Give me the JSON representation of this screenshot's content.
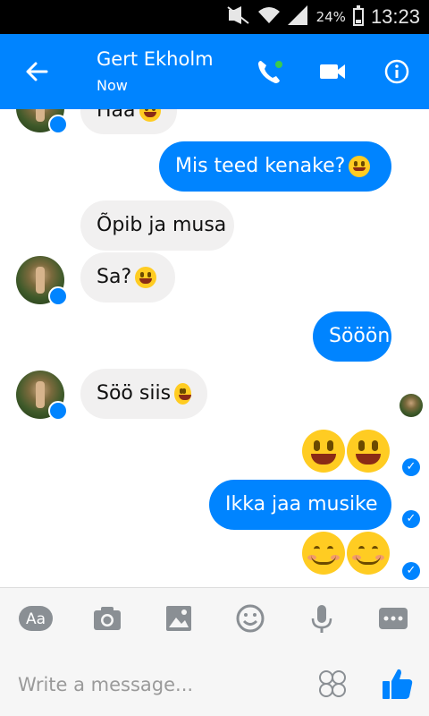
{
  "status_bar": {
    "battery_percent": "24%",
    "time": "13:23",
    "icons": [
      "mute-icon",
      "wifi-icon",
      "signal-icon",
      "battery-icon"
    ]
  },
  "header": {
    "contact_name": "Gert Ekholm",
    "contact_status": "Now",
    "icons": [
      "back-arrow-icon",
      "phone-icon",
      "video-camera-icon",
      "info-icon"
    ],
    "accent_color": "#0084ff"
  },
  "messages": [
    {
      "direction": "in",
      "text": "Hää",
      "emoji": "grin"
    },
    {
      "direction": "out",
      "text": "Mis teed kenake?",
      "emoji": "smile"
    },
    {
      "direction": "in",
      "text": "Õpib ja musa",
      "emoji": null
    },
    {
      "direction": "in",
      "text": "Sa?",
      "emoji": "grin"
    },
    {
      "direction": "out",
      "text": "Sööön",
      "emoji": null
    },
    {
      "direction": "in",
      "text": "Söö siis",
      "emoji": "grin"
    },
    {
      "direction": "out",
      "text": "",
      "emoji": "grin-grin"
    },
    {
      "direction": "out",
      "text": "Ikka jaa musike",
      "emoji": null
    },
    {
      "direction": "out",
      "text": "",
      "emoji": "blush-blush"
    }
  ],
  "toolbar": {
    "text_button_label": "Aa",
    "icons": [
      "camera-icon",
      "gallery-icon",
      "emoji-icon",
      "microphone-icon",
      "more-icon"
    ]
  },
  "composer": {
    "placeholder": "Write a message...",
    "icons": [
      "sticker-icon",
      "like-icon"
    ]
  }
}
